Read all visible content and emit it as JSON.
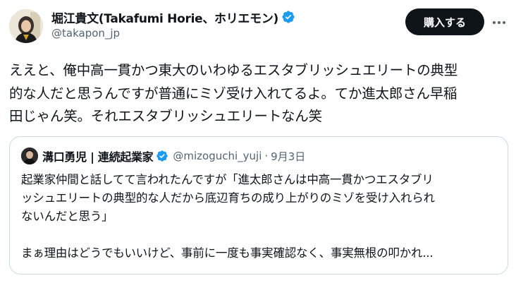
{
  "author": {
    "display_name": "堀江貴文(Takafumi Horie、ホリエモン)",
    "handle": "@takapon_jp"
  },
  "actions": {
    "buy_label": "購入する"
  },
  "tweet": {
    "lines": [
      "ええと、俺中高一貫かつ東大のいわゆるエスタブリッシュエリートの典型",
      "的な人だと思うんですが普通にミゾ受け入れてるよ。てか進太郎さん早稲",
      "田じゃん笑。それエスタブリッシュエリートなん笑"
    ]
  },
  "quote": {
    "author_name": "溝口勇児 | 連続起業家",
    "handle": "@mizoguchi_yuji",
    "separator": "·",
    "date": "9月3日",
    "lines": [
      "起業家仲間と話してて言われたんですが「進太郎さんは中高一貫かつエスタブリ",
      "ッシュエリートの典型的な人だから底辺育ちの成り上がりのミゾを受け入れられ",
      "ないんだと思う」",
      "",
      "まぁ理由はどうでもいいけど、事前に一度も事実確認なく、事実無根の叩かれ..."
    ]
  },
  "icons": {
    "verified": "verified-badge-icon",
    "more": "more-options-icon"
  },
  "colors": {
    "verified": "#1d9bf0",
    "button_bg": "#0f1419",
    "secondary_text": "#536471",
    "border": "#cfd9de"
  }
}
